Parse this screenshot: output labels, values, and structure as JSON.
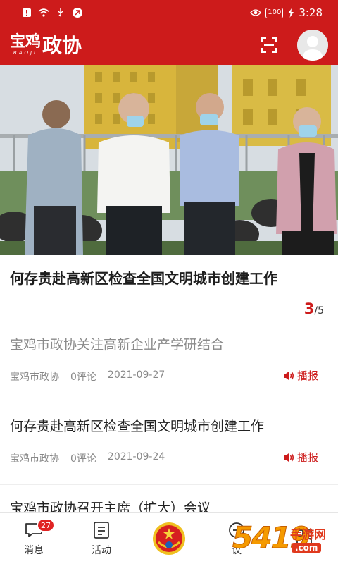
{
  "status_bar": {
    "battery": "100",
    "time": "3:28"
  },
  "header": {
    "logo_main": "宝鸡",
    "logo_sub": "BAOJI",
    "logo_suffix": "政协"
  },
  "carousel": {
    "headline": "何存贵赴高新区检查全国文明城市创建工作",
    "current": "3",
    "total": "/5"
  },
  "news": [
    {
      "title": "宝鸡市政协关注高新企业产学研结合",
      "source": "宝鸡市政协",
      "comments": "0评论",
      "date": "2021-09-27",
      "action": "播报",
      "read": true
    },
    {
      "title": "何存贵赴高新区检查全国文明城市创建工作",
      "source": "宝鸡市政协",
      "comments": "0评论",
      "date": "2021-09-24",
      "action": "播报",
      "read": false
    },
    {
      "title": "宝鸡市政协召开主席（扩大）会议"
    }
  ],
  "tabbar": {
    "items": [
      {
        "label": "消息",
        "badge": "27",
        "icon": "message-icon"
      },
      {
        "label": "活动",
        "icon": "activity-list-icon"
      },
      {
        "label": "",
        "icon": "cppcc-emblem-icon"
      },
      {
        "label": "议",
        "icon": "discussion-icon"
      },
      {
        "label": "",
        "icon": "grid-apps-icon"
      }
    ]
  },
  "watermark": {
    "digits": "5419",
    "brand": "手游网",
    "domain": ".com"
  },
  "colors": {
    "brand_red": "#cd1b1b",
    "meta_gray": "#888888"
  }
}
